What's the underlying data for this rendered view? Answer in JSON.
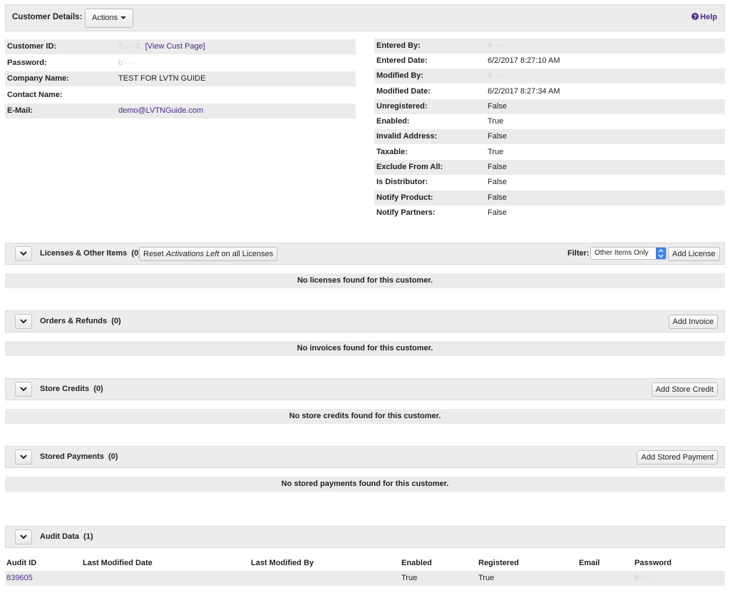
{
  "header": {
    "title": "Customer Details:",
    "actions_label": "Actions",
    "help_label": "Help"
  },
  "left_details": [
    {
      "label": "Customer ID:",
      "value": "2·····3",
      "link": "[View Cust Page]"
    },
    {
      "label": "Password:",
      "value": "b·····"
    },
    {
      "label": "Company Name:",
      "value": "TEST FOR LVTN GUIDE"
    },
    {
      "label": "Contact Name:",
      "value": ""
    },
    {
      "label": "E-Mail:",
      "value": "demo@LVTNGuide.com"
    }
  ],
  "right_details": [
    {
      "label": "Entered By:",
      "value": "4·····"
    },
    {
      "label": "Entered Date:",
      "value": "6/2/2017 8:27:10 AM"
    },
    {
      "label": "Modified By:",
      "value": "4·····"
    },
    {
      "label": "Modified Date:",
      "value": "6/2/2017 8:27:34 AM"
    },
    {
      "label": "Unregistered:",
      "value": "False"
    },
    {
      "label": "Enabled:",
      "value": "True"
    },
    {
      "label": "Invalid Address:",
      "value": "False"
    },
    {
      "label": "Taxable:",
      "value": "True"
    },
    {
      "label": "Exclude From All:",
      "value": "False"
    },
    {
      "label": "Is Distributor:",
      "value": "False"
    },
    {
      "label": "Notify Product:",
      "value": "False"
    },
    {
      "label": "Notify Partners:",
      "value": "False"
    }
  ],
  "licenses": {
    "title": "Licenses & Other Items",
    "count": "(0)",
    "reset_prefix": "Reset ",
    "reset_em": "Activations Left",
    "reset_suffix": " on all Licenses",
    "filter_label": "Filter:",
    "filter_value": "Other Items Only",
    "add_label": "Add License",
    "empty": "No licenses found for this customer."
  },
  "orders": {
    "title": "Orders & Refunds",
    "count": "(0)",
    "add_label": "Add Invoice",
    "empty": "No invoices found for this customer."
  },
  "credits": {
    "title": "Store Credits",
    "count": "(0)",
    "add_label": "Add Store Credit",
    "empty": "No store credits found for this customer."
  },
  "payments": {
    "title": "Stored Payments",
    "count": "(0)",
    "add_label": "Add Stored Payment",
    "empty": "No stored payments found for this customer."
  },
  "audit": {
    "title": "Audit Data",
    "count": "(1)",
    "columns": [
      "Audit ID",
      "Last Modified Date",
      "Last Modified By",
      "Enabled",
      "Registered",
      "Email",
      "Password"
    ],
    "rows": [
      {
        "audit_id": "839605",
        "last_modified_date": "",
        "last_modified_by": "",
        "enabled": "True",
        "registered": "True",
        "email": "",
        "password": "b·····"
      }
    ]
  },
  "colors": {
    "link": "#4a2a8a",
    "help": "#4a2a8a",
    "bar_bg": "#ececec",
    "row_shade": "#ebebeb"
  },
  "icons": {
    "help": "question-circle-icon",
    "toggle": "chevron-down-icon",
    "caret": "caret-down-icon",
    "select": "select-arrows-icon"
  }
}
